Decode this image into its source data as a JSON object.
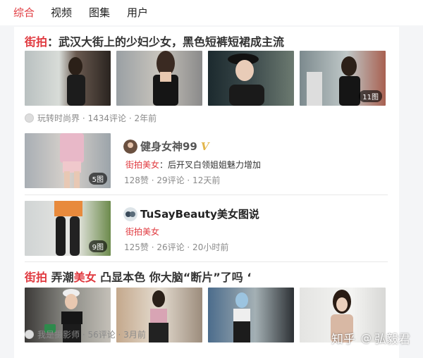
{
  "tabs": [
    "综合",
    "视频",
    "图集",
    "用户"
  ],
  "active_tab": "综合",
  "item1": {
    "title_keyword": "街拍",
    "title_rest": "：武汉大街上的少妇少女，黑色短裤短裙成主流",
    "image_count": "11图",
    "author": "玩转时尚界",
    "meta": "1434评论 · 2年前"
  },
  "item2": {
    "image_count": "5图",
    "author": "健身女神99",
    "verified_mark": "V",
    "tag": "街拍美女",
    "desc": "：后开叉白领姐姐魅力增加",
    "stats": "128赞 · 29评论 · 12天前"
  },
  "item3": {
    "image_count": "9图",
    "author": "TuSayBeauty美女图说",
    "tag": "街拍美女",
    "stats": "125赞 · 26评论 · 20小时前"
  },
  "item4": {
    "title_keyword1": "街拍",
    "title_mid": " 弄潮",
    "title_keyword2": "美女",
    "title_rest": " 凸显本色 你大脑“断片”了吗 ‘",
    "author": "我是摄影师",
    "meta": "56评论 · 3月前"
  },
  "watermark": {
    "brand": "知乎",
    "at": "@",
    "user": "弘毅君"
  },
  "colors": {
    "accent": "#e0383e",
    "meta": "#8a8a8a",
    "verified": "#e3b64a"
  }
}
